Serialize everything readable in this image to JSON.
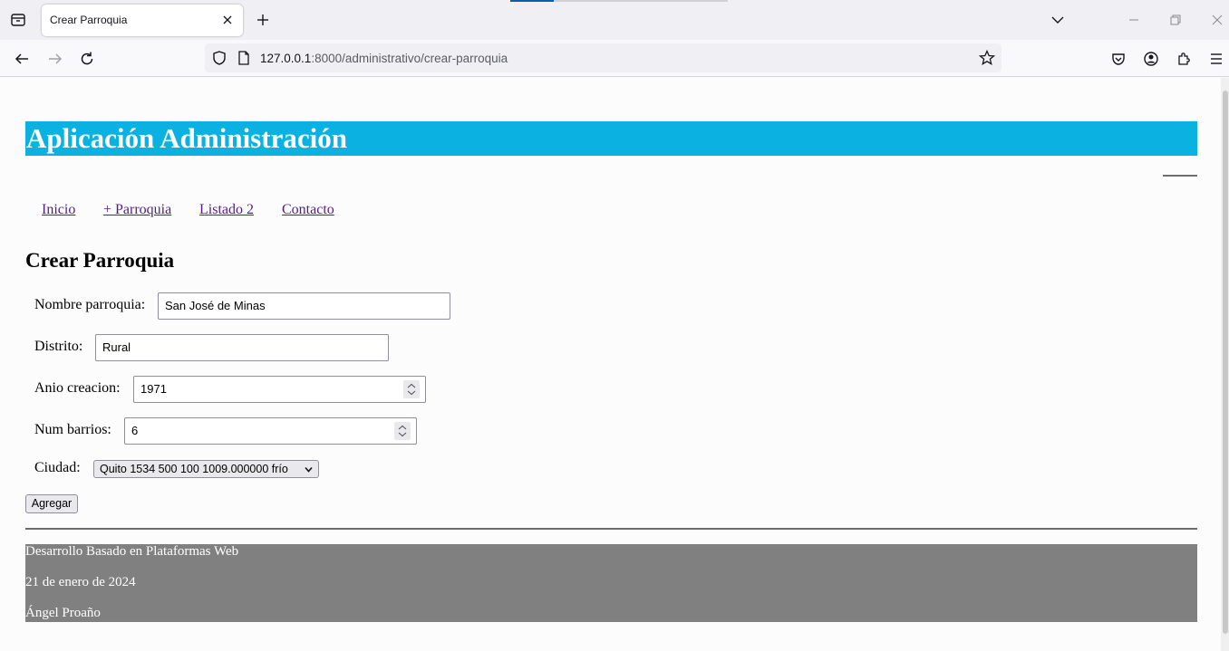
{
  "browser": {
    "tab_title": "Crear Parroquia",
    "url_host": "127.0.0.1",
    "url_rest": ":8000/administrativo/crear-parroquia"
  },
  "page": {
    "header_title": "Aplicación Administración",
    "menu": [
      "Inicio",
      "+ Parroquia",
      "Listado 2",
      "Contacto"
    ],
    "form_title": "Crear Parroquia",
    "fields": {
      "nombre": {
        "label": "Nombre parroquia:",
        "value": "San José de Minas"
      },
      "distrito": {
        "label": "Distrito:",
        "value": "Rural"
      },
      "anio": {
        "label": "Anio creacion:",
        "value": "1971"
      },
      "barrios": {
        "label": "Num barrios:",
        "value": "6"
      },
      "ciudad": {
        "label": "Ciudad:",
        "value": "Quito 1534 500 100 1009.000000 frío"
      }
    },
    "submit_label": "Agregar",
    "footer": [
      "Desarrollo Basado en Plataformas Web",
      "21 de enero de 2024",
      "Ángel Proaño"
    ]
  },
  "colors": {
    "header_bg": "#0bb1e1",
    "footer_bg": "#808080",
    "link": "#551a8b"
  }
}
